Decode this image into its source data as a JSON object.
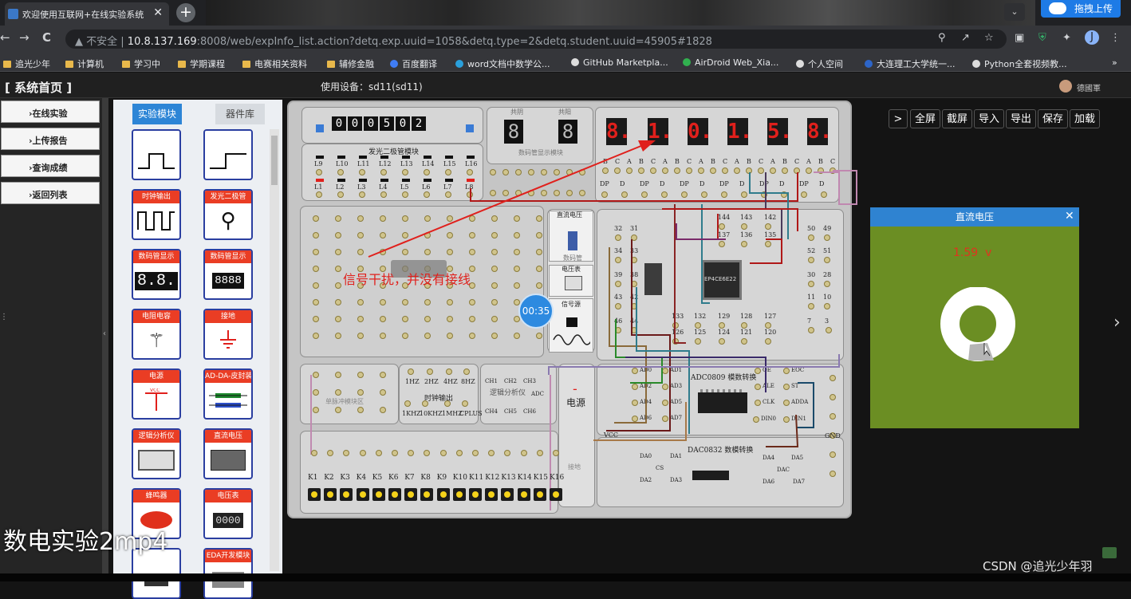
{
  "browser": {
    "tab_title": "欢迎使用互联网+在线实验系统",
    "tab_close": "✕",
    "new_tab": "+",
    "tab_dropdown": "⌄",
    "ext_upload": "拖拽上传",
    "nav": {
      "back": "←",
      "forward": "→",
      "reload": "C"
    },
    "security": "▲ 不安全 |",
    "url_host": "10.8.137.169",
    "url_rest": ":8008/web/expInfo_list.action?detq.exp.uuid=1058&detq.type=2&detq.student.uuid=45905#1828",
    "bookmarks": [
      "追光少年",
      "计算机",
      "学习中",
      "学期课程",
      "电赛相关资料",
      "辅修金融",
      "百度翻译",
      "word文档中数学公...",
      "GitHub Marketpla...",
      "AirDroid Web_Xia...",
      "个人空间",
      "大连理工大学统一...",
      "Python全套视频教..."
    ],
    "bookmarks_more": "»",
    "profile_initial": "J"
  },
  "app": {
    "home": "[ 系统首页 ]",
    "device_label": "使用设备：sd11(sd11)",
    "user_name": "德國軍",
    "nav": [
      "›在线实验",
      "›上传报告",
      "›查询成绩",
      "›返回列表"
    ],
    "tabs": {
      "experiment": "实验模块",
      "library": "器件库"
    },
    "modules": [
      {
        "caption": "",
        "icon": "pulse-single-icon"
      },
      {
        "caption": "",
        "icon": "pulse-step-icon"
      },
      {
        "caption": "时钟输出",
        "icon": "clock-wave-icon"
      },
      {
        "caption": "发光二极管",
        "icon": "led-icon"
      },
      {
        "caption": "数码管显示",
        "icon": "seven-seg-2-icon"
      },
      {
        "caption": "数码管显示",
        "icon": "seven-seg-4-icon"
      },
      {
        "caption": "电阻电容",
        "icon": "resistor-icon"
      },
      {
        "caption": "接地",
        "icon": "ground-icon"
      },
      {
        "caption": "电源",
        "icon": "vcc-icon"
      },
      {
        "caption": "AD-DA-皮封装",
        "icon": "adda-icon"
      },
      {
        "caption": "逻辑分析仪",
        "icon": "logic-analyzer-icon"
      },
      {
        "caption": "直流电压",
        "icon": "dc-supply-icon"
      },
      {
        "caption": "蜂鸣器",
        "icon": "buzzer-icon"
      },
      {
        "caption": "电压表",
        "icon": "voltmeter-icon"
      },
      {
        "caption": "",
        "icon": "module-icon"
      },
      {
        "caption": "EDA开发模块",
        "icon": "eda-icon"
      }
    ],
    "module_glyphs": {
      "seven_seg_2": "8.8.",
      "seven_seg_4": "8888",
      "voltmeter": "0000",
      "vcc": "VCC",
      "gnd": "GND"
    },
    "toolbar": [
      "全屏",
      "截屏",
      "导入",
      "导出",
      "保存",
      "加载"
    ],
    "toolbar_arrow": ">"
  },
  "board": {
    "counter_digits": [
      "0",
      "0",
      "0",
      "5",
      "0",
      "2"
    ],
    "digit_tube_labels": [
      "8",
      "8"
    ],
    "digit_tube_titles": [
      "共阴",
      "共阳"
    ],
    "digit_tube_module": "数码管显示模块",
    "seven_seg": [
      "8",
      "1",
      "0",
      "1",
      "5",
      "8"
    ],
    "seven_seg_display": [
      "8.",
      "1.",
      "0.",
      "1.",
      "5.",
      "8."
    ],
    "seg_pins_row1": [
      "B",
      "C",
      "A",
      "B",
      "C",
      "A",
      "B",
      "C",
      "A",
      "B",
      "C",
      "A",
      "B",
      "C",
      "A",
      "B",
      "C",
      "A",
      "B",
      "C"
    ],
    "seg_pins_row2": [
      "DP",
      "D",
      "DP",
      "D",
      "DP",
      "D",
      "DP",
      "D",
      "DP",
      "D",
      "DP",
      "D"
    ],
    "led_module_title": "发光二极管模块",
    "led_top": [
      "L9",
      "L10",
      "L11",
      "L12",
      "L13",
      "L14",
      "L15",
      "L16"
    ],
    "led_bottom": [
      "L1",
      "L2",
      "L3",
      "L4",
      "L5",
      "L6",
      "L7",
      "L8"
    ],
    "chip_label": "EP4CE6E22",
    "fpga_pins": [
      "32",
      "31",
      "34",
      "33",
      "39",
      "38",
      "43",
      "42",
      "46",
      "44",
      "144",
      "143",
      "142",
      "137",
      "136",
      "135",
      "133",
      "132",
      "129",
      "128",
      "127",
      "126",
      "125",
      "124",
      "121",
      "120",
      "50",
      "49",
      "52",
      "51",
      "30",
      "28",
      "11",
      "10",
      "7",
      "3"
    ],
    "dc_label": "直流电压",
    "dc_small": "数码管",
    "voltmeter": "电压表",
    "signal_source": "信号源",
    "clock_freqs": [
      "1HZ",
      "2HZ",
      "4HZ",
      "8HZ",
      "1KHZ",
      "10KHZ",
      "1MHZ",
      "CPLUS"
    ],
    "clock_out": "时钟输出",
    "logic_analyzer": "逻辑分析仪",
    "logic_channels": [
      "CH1",
      "CH2",
      "CH3",
      "CH4",
      "CH5",
      "CH6",
      "ADC"
    ],
    "pulse_label": "单脉冲模块区",
    "adc_title": "ADC0809 模数转换",
    "adc_pins": [
      "AD0",
      "AD1",
      "AD2",
      "AD3",
      "AD4",
      "AD5",
      "AD6",
      "AD7",
      "OE",
      "EOC",
      "ALE",
      "ST",
      "CLK",
      "ADDA",
      "DIN0",
      "DIN1"
    ],
    "dac_title": "DAC0832 数模转换",
    "dac_pins": [
      "DA0",
      "DA1",
      "CS",
      "DA2",
      "DA3",
      "DA4",
      "DA5",
      "DAC",
      "DA6",
      "DA7"
    ],
    "vcc": "VCC",
    "gnd": "GND",
    "power_sign": "-",
    "power_label": "电源",
    "small_label": "接地",
    "keys": [
      "K1",
      "K2",
      "K3",
      "K4",
      "K5",
      "K6",
      "K7",
      "K8",
      "K9",
      "K10",
      "K11",
      "K12",
      "K13",
      "K14",
      "K15",
      "K16"
    ]
  },
  "dc_window": {
    "title": "直流电压",
    "close": "✕",
    "value": "1.59",
    "unit": "v"
  },
  "timer": "00:35",
  "annotation": "信号干扰，并没有接线",
  "video_title": "数电实验2mp4",
  "watermark": "CSDN @追光少年羽",
  "side_arrow": "›",
  "colors": {
    "accent": "#2d85d6",
    "segment_red": "#e0201c",
    "module_red": "#ea3d24",
    "dc_green": "#6b8e23",
    "wire_red": "#b01818"
  }
}
